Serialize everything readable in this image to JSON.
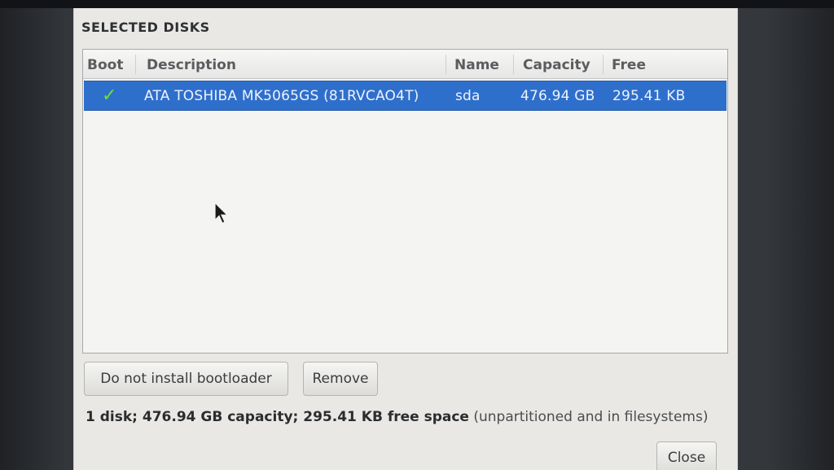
{
  "dialog": {
    "title": "SELECTED DISKS"
  },
  "table": {
    "columns": [
      "Boot",
      "Description",
      "Name",
      "Capacity",
      "Free"
    ],
    "rows": [
      {
        "boot_icon": "checkmark-icon",
        "description": "ATA TOSHIBA MK5065GS (81RVCAO4T)",
        "name": "sda",
        "capacity": "476.94 GB",
        "free": "295.41 KB",
        "selected": true
      }
    ]
  },
  "buttons": {
    "no_bootloader": "Do not install bootloader",
    "remove": "Remove",
    "close": "Close"
  },
  "summary": {
    "bold": "1 disk; 476.94 GB capacity; 295.41 KB free space",
    "light": "(unpartitioned and in filesystems)"
  },
  "colors": {
    "selection": "#2f6fcc",
    "check": "#6fdc3a",
    "dialog_bg": "#e9e8e5"
  }
}
